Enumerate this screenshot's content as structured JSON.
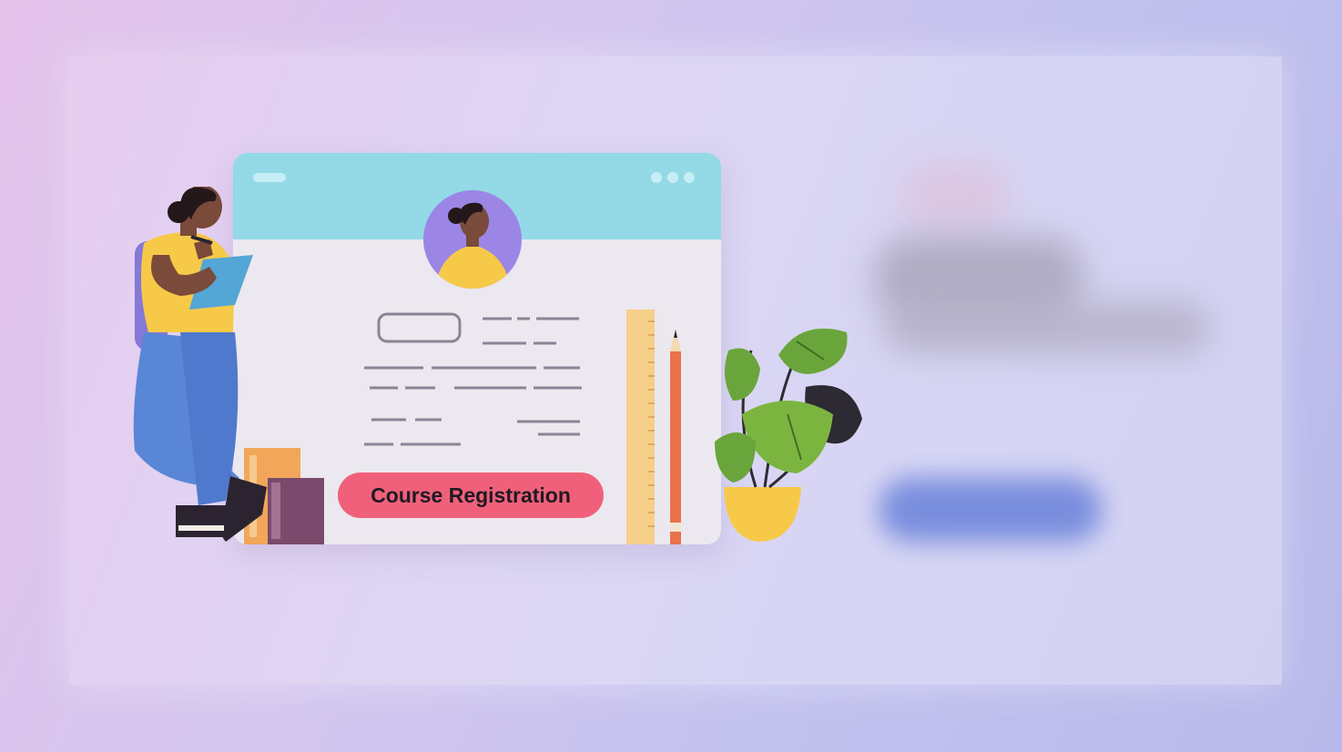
{
  "registration": {
    "button_label": "Course Registration"
  },
  "colors": {
    "titlebar": "#93d9e6",
    "button": "#f0607a",
    "avatar_bg": "#9b86e6",
    "shirt": "#f7c948",
    "jeans": "#5a86d8"
  },
  "icons": [
    "student-illustration",
    "avatar-icon",
    "ruler-icon",
    "pencil-icon",
    "books-icon",
    "plant-icon"
  ]
}
